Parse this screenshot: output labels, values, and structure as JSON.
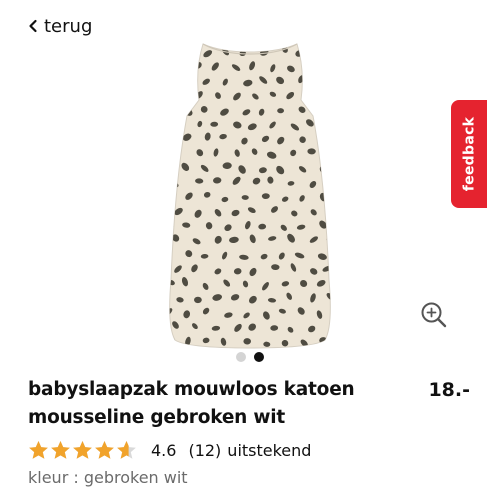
{
  "header": {
    "back_label": "terug"
  },
  "feedback": {
    "label": "feedback"
  },
  "gallery": {
    "image_count": 2,
    "active_index": 1
  },
  "product": {
    "title": "babyslaapzak mouwloos katoen mousseline gebroken wit",
    "price": "18.-",
    "rating": {
      "value": "4.6",
      "count": "(12)",
      "label": "uitstekend",
      "stars": 4.6
    },
    "color": "kleur : gebroken wit"
  },
  "colors": {
    "accent": "#e5232f",
    "star": "#f1a32b",
    "star_empty": "#d9d9d9",
    "fabric": "#ede5d6",
    "spots": "#4f4c42",
    "muted_text": "#6b6b6b",
    "dot_active": "#111111",
    "dot_inactive": "#d4d4d4"
  },
  "icons": {
    "back": "chevron-left-icon",
    "zoom": "zoom-in-icon"
  }
}
